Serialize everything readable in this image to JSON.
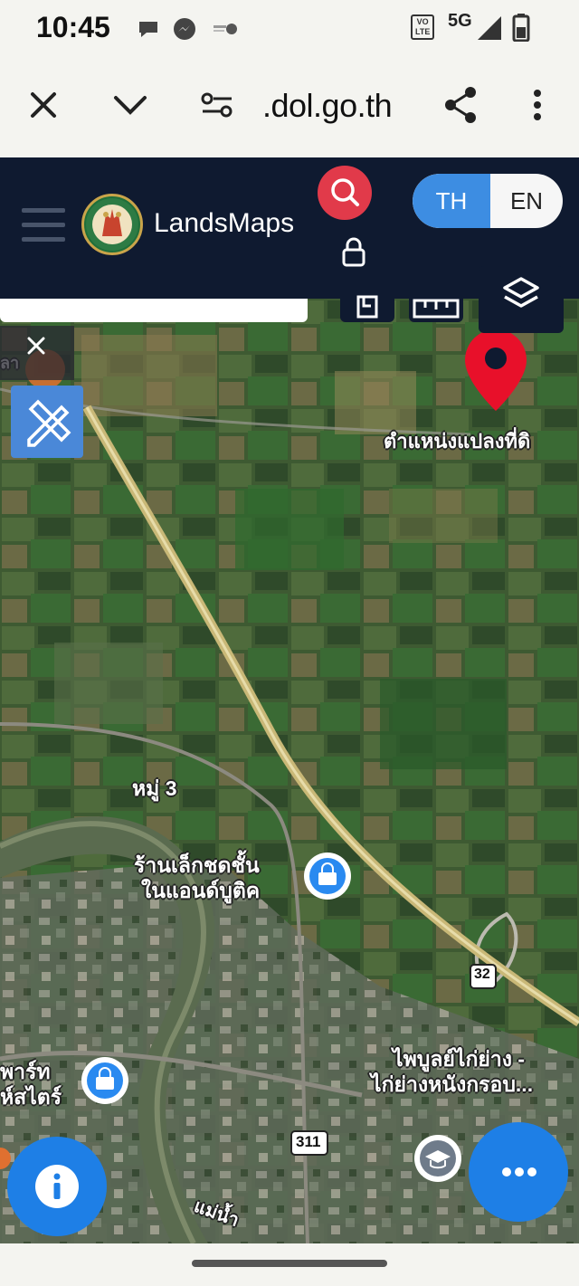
{
  "status_bar": {
    "time": "10:45",
    "network_badge_top": "VO",
    "network_badge_bottom": "LTE",
    "network_type": "5G",
    "icons": [
      "chat-bubble-icon",
      "messenger-icon",
      "app-notification-icon",
      "signal-icon",
      "battery-icon"
    ]
  },
  "browser": {
    "url": ".dol.go.th",
    "icons": [
      "close-icon",
      "chevron-down-icon",
      "site-settings-icon",
      "share-icon",
      "more-vert-icon"
    ]
  },
  "app": {
    "brand": "LandsMaps",
    "lang_th": "TH",
    "lang_en": "EN",
    "colors": {
      "header": "#0f1a30",
      "accent_blue": "#1e7fe6",
      "search_red": "#e13a4a",
      "pin_red": "#e8102a"
    }
  },
  "map": {
    "labels": {
      "pin_label": "ตำแหน่งแปลงที่ดิ",
      "village": "หมู่ 3",
      "shop_line1": "ร้านเล็กชดชั้น",
      "shop_line2": "ในแอนด์บูติค",
      "restaurant_line1": "ไพบูลย์ไก่ย่าง -",
      "restaurant_line2": "ไก่ย่างหนังกรอบ...",
      "left_line1": "พาร์ท",
      "left_line2": "ห์สไตร์",
      "road_32": "32",
      "road_311": "311",
      "river": "แม่น้ำ",
      "partial_left": "ลา"
    },
    "icons": [
      "map-pin-icon",
      "shopping-bag-icon",
      "graduation-cap-icon",
      "restaurant-icon",
      "layers-icon",
      "draw-tools-icon",
      "info-icon",
      "more-horizontal-icon",
      "close-icon",
      "lock-icon",
      "search-icon"
    ]
  }
}
